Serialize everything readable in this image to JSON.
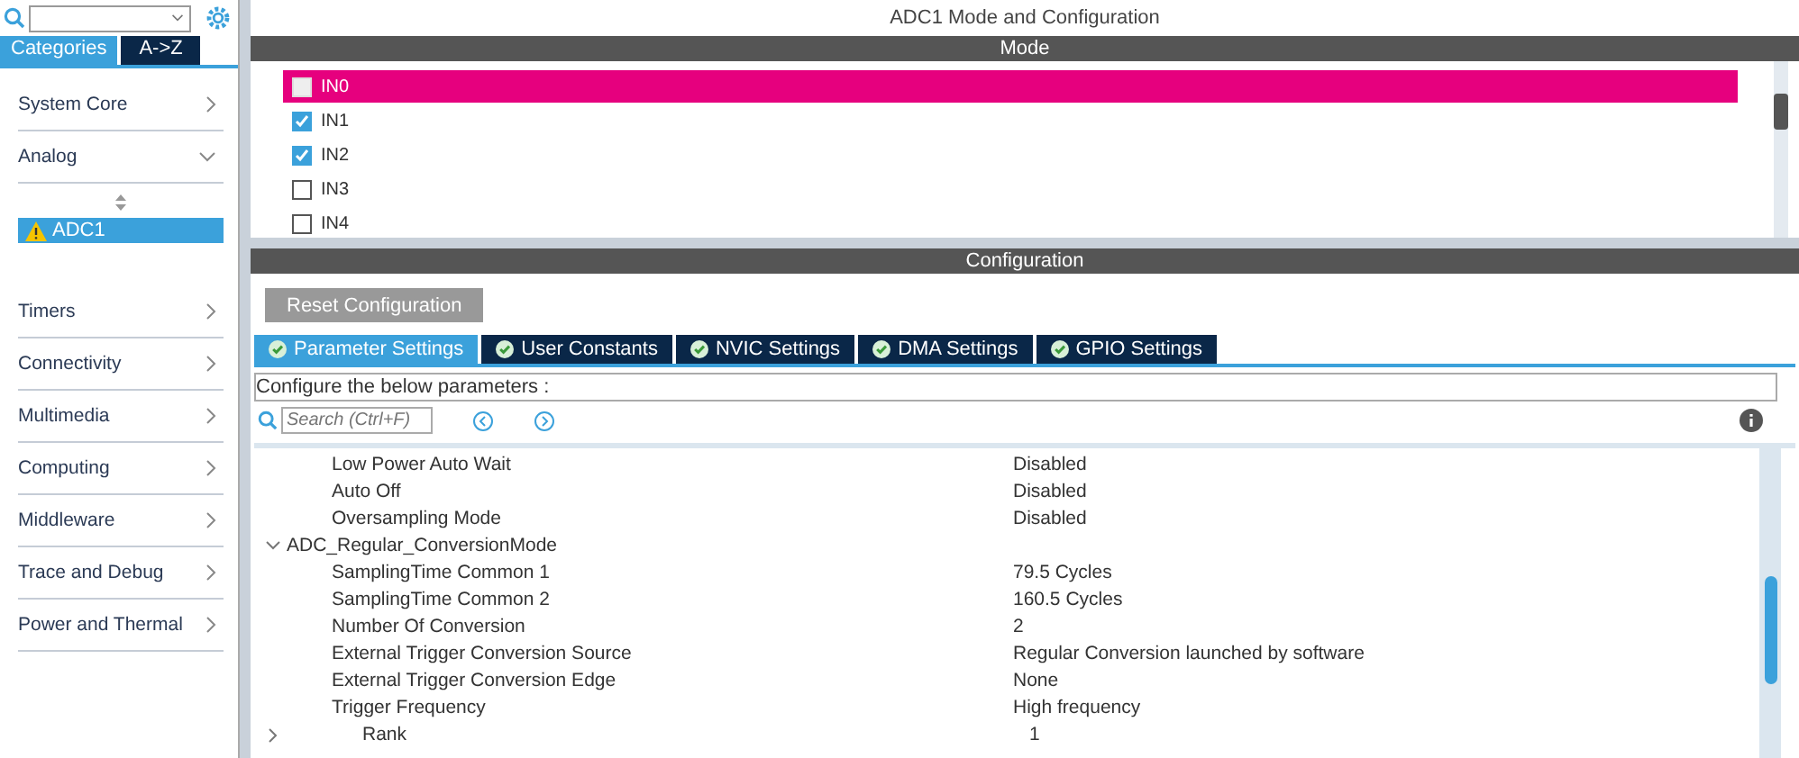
{
  "sidebar": {
    "tabs": [
      {
        "label": "Categories",
        "selected": true
      },
      {
        "label": "A->Z",
        "selected": false
      }
    ],
    "categories": [
      {
        "label": "System Core",
        "expanded": false
      },
      {
        "label": "Analog",
        "expanded": true,
        "children": [
          {
            "label": "ADC1",
            "selected": true,
            "warning": true
          }
        ]
      },
      {
        "label": "Timers",
        "expanded": false
      },
      {
        "label": "Connectivity",
        "expanded": false
      },
      {
        "label": "Multimedia",
        "expanded": false
      },
      {
        "label": "Computing",
        "expanded": false
      },
      {
        "label": "Middleware",
        "expanded": false
      },
      {
        "label": "Trace and Debug",
        "expanded": false
      },
      {
        "label": "Power and Thermal",
        "expanded": false
      }
    ]
  },
  "main": {
    "title": "ADC1 Mode and Configuration",
    "mode": {
      "header": "Mode",
      "channels": [
        {
          "label": "IN0",
          "checked": false,
          "highlighted": true
        },
        {
          "label": "IN1",
          "checked": true,
          "highlighted": false
        },
        {
          "label": "IN2",
          "checked": true,
          "highlighted": false
        },
        {
          "label": "IN3",
          "checked": false,
          "highlighted": false
        },
        {
          "label": "IN4",
          "checked": false,
          "highlighted": false
        }
      ]
    },
    "configuration": {
      "header": "Configuration",
      "reset_button": "Reset Configuration",
      "tabs": [
        {
          "label": "Parameter Settings",
          "selected": true
        },
        {
          "label": "User Constants",
          "selected": false
        },
        {
          "label": "NVIC Settings",
          "selected": false
        },
        {
          "label": "DMA Settings",
          "selected": false
        },
        {
          "label": "GPIO Settings",
          "selected": false
        }
      ],
      "description": "Configure the below parameters :",
      "search": {
        "placeholder": "Search (Ctrl+F)"
      },
      "parameters": [
        {
          "kind": "param",
          "label": "Low Power Auto Wait",
          "value": "Disabled"
        },
        {
          "kind": "param",
          "label": "Auto Off",
          "value": "Disabled"
        },
        {
          "kind": "param",
          "label": "Oversampling Mode",
          "value": "Disabled"
        },
        {
          "kind": "group",
          "label": "ADC_Regular_ConversionMode",
          "expanded": true
        },
        {
          "kind": "param",
          "label": "SamplingTime Common 1",
          "value": "79.5 Cycles"
        },
        {
          "kind": "param",
          "label": "SamplingTime Common 2",
          "value": "160.5 Cycles"
        },
        {
          "kind": "param",
          "label": "Number Of Conversion",
          "value": "2"
        },
        {
          "kind": "param",
          "label": "External Trigger Conversion Source",
          "value": "Regular Conversion launched by software"
        },
        {
          "kind": "param",
          "label": "External Trigger Conversion Edge",
          "value": "None"
        },
        {
          "kind": "param",
          "label": "Trigger Frequency",
          "value": "High frequency"
        },
        {
          "kind": "subgroup",
          "label": "Rank",
          "value": "1",
          "expanded": false
        }
      ]
    }
  }
}
